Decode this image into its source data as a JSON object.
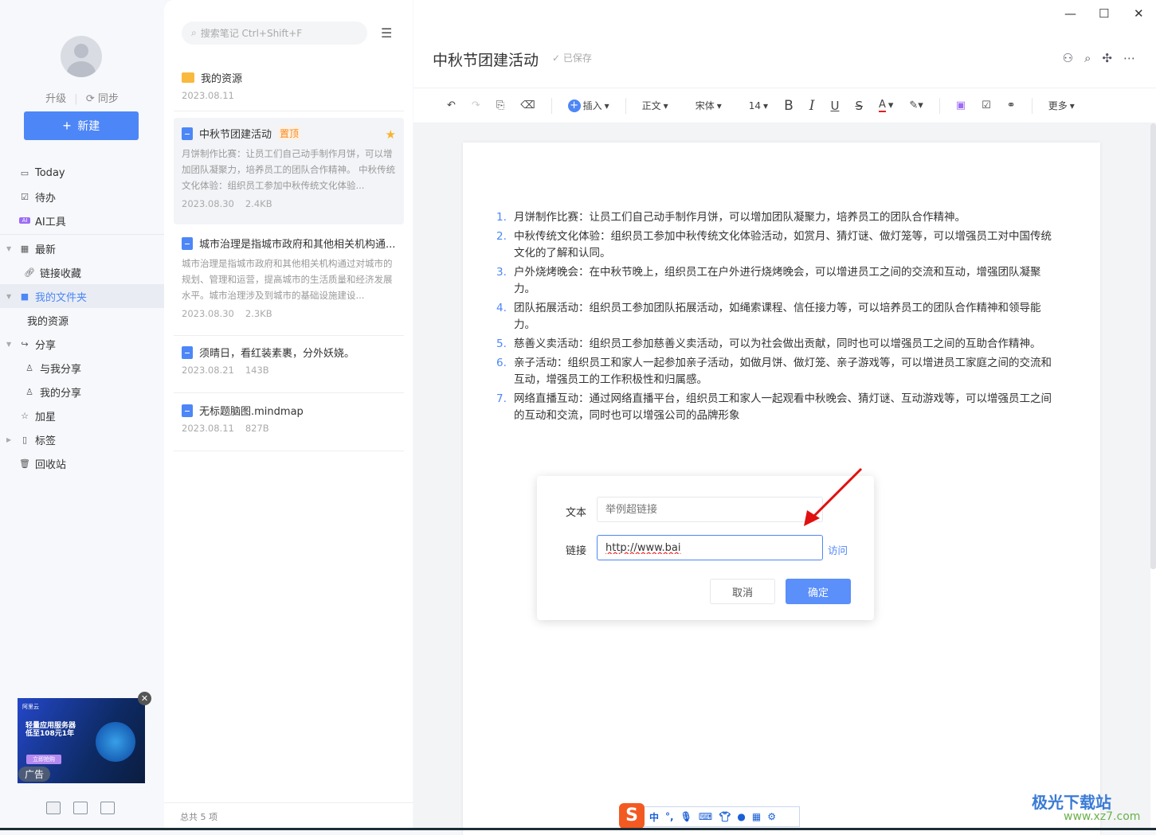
{
  "sidebar": {
    "upgrade": "升级",
    "sync": "同步",
    "new_button": "新建",
    "items": [
      {
        "label": "Today",
        "icon": "calendar-icon"
      },
      {
        "label": "待办",
        "icon": "checkbox-icon"
      },
      {
        "label": "AI工具",
        "icon": "ai-icon"
      },
      {
        "label": "最新",
        "icon": "grid-icon"
      },
      {
        "label": "链接收藏",
        "icon": "link-icon"
      },
      {
        "label": "我的文件夹",
        "icon": "folder-icon"
      },
      {
        "label": "我的资源"
      },
      {
        "label": "分享",
        "icon": "share-icon"
      },
      {
        "label": "与我分享",
        "icon": "user-icon"
      },
      {
        "label": "我的分享",
        "icon": "user-icon"
      },
      {
        "label": "加星",
        "icon": "star-icon"
      },
      {
        "label": "标签",
        "icon": "tag-icon"
      },
      {
        "label": "回收站",
        "icon": "trash-icon"
      }
    ],
    "ad": {
      "label": "广告",
      "brand": "阿里云",
      "headline": "轻量应用服务器",
      "offer": "低至108元1年",
      "cta": "立即抢购"
    }
  },
  "list": {
    "search_placeholder": "搜索笔记 Ctrl+Shift+F",
    "total": "总共 5 项",
    "items": [
      {
        "title": "我的资源",
        "date": "2023.08.11",
        "type": "folder"
      },
      {
        "title": "中秋节团建活动",
        "badge": "置顶",
        "starred": true,
        "preview": "月饼制作比赛：让员工们自己动手制作月饼，可以增加团队凝聚力，培养员工的团队合作精神。 中秋传统文化体验：组织员工参加中秋传统文化体验...",
        "date": "2023.08.30",
        "size": "2.4KB"
      },
      {
        "title": "城市治理是指城市政府和其他相关机构通...",
        "preview": "城市治理是指城市政府和其他相关机构通过对城市的规划、管理和运营，提高城市的生活质量和经济发展水平。城市治理涉及到城市的基础设施建设...",
        "date": "2023.08.30",
        "size": "2.3KB"
      },
      {
        "title": "须晴日，看红装素裹，分外妖娆。",
        "date": "2023.08.21",
        "size": "143B"
      },
      {
        "title": "无标题脑图.mindmap",
        "date": "2023.08.11",
        "size": "827B"
      }
    ]
  },
  "editor": {
    "title": "中秋节团建活动",
    "saved": "已保存",
    "toolbar": {
      "insert": "插入",
      "style": "正文",
      "font": "宋体",
      "size": "14",
      "more": "更多",
      "font_color": "#e02020"
    },
    "content": [
      "月饼制作比赛：让员工们自己动手制作月饼，可以增加团队凝聚力，培养员工的团队合作精神。",
      "中秋传统文化体验：组织员工参加中秋传统文化体验活动，如赏月、猜灯谜、做灯笼等，可以增强员工对中国传统文化的了解和认同。",
      "户外烧烤晚会：在中秋节晚上，组织员工在户外进行烧烤晚会，可以增进员工之间的交流和互动，增强团队凝聚力。",
      "团队拓展活动：组织员工参加团队拓展活动，如绳索课程、信任接力等，可以培养员工的团队合作精神和领导能力。",
      "慈善义卖活动：组织员工参加慈善义卖活动，可以为社会做出贡献，同时也可以增强员工之间的互助合作精神。",
      "亲子活动：组织员工和家人一起参加亲子活动，如做月饼、做灯笼、亲子游戏等，可以增进员工家庭之间的交流和互动，增强员工的工作积极性和归属感。",
      "网络直播互动：通过网络直播平台，组织员工和家人一起观看中秋晚会、猜灯谜、互动游戏等，可以增强员工之间的互动和交流，同时也可以增强公司的品牌形象"
    ],
    "link_dialog": {
      "text_label": "文本",
      "text_placeholder": "举例超链接",
      "link_label": "链接",
      "link_value": "http://www.bai",
      "visit": "访问",
      "cancel": "取消",
      "confirm": "确定"
    }
  },
  "ime": {
    "mode": "中"
  },
  "watermark": {
    "name": "极光下载站",
    "url": "www.xz7.com"
  },
  "colors": {
    "accent": "#4d86f7",
    "pin": "#f58a1f",
    "star": "#f7b52c"
  }
}
